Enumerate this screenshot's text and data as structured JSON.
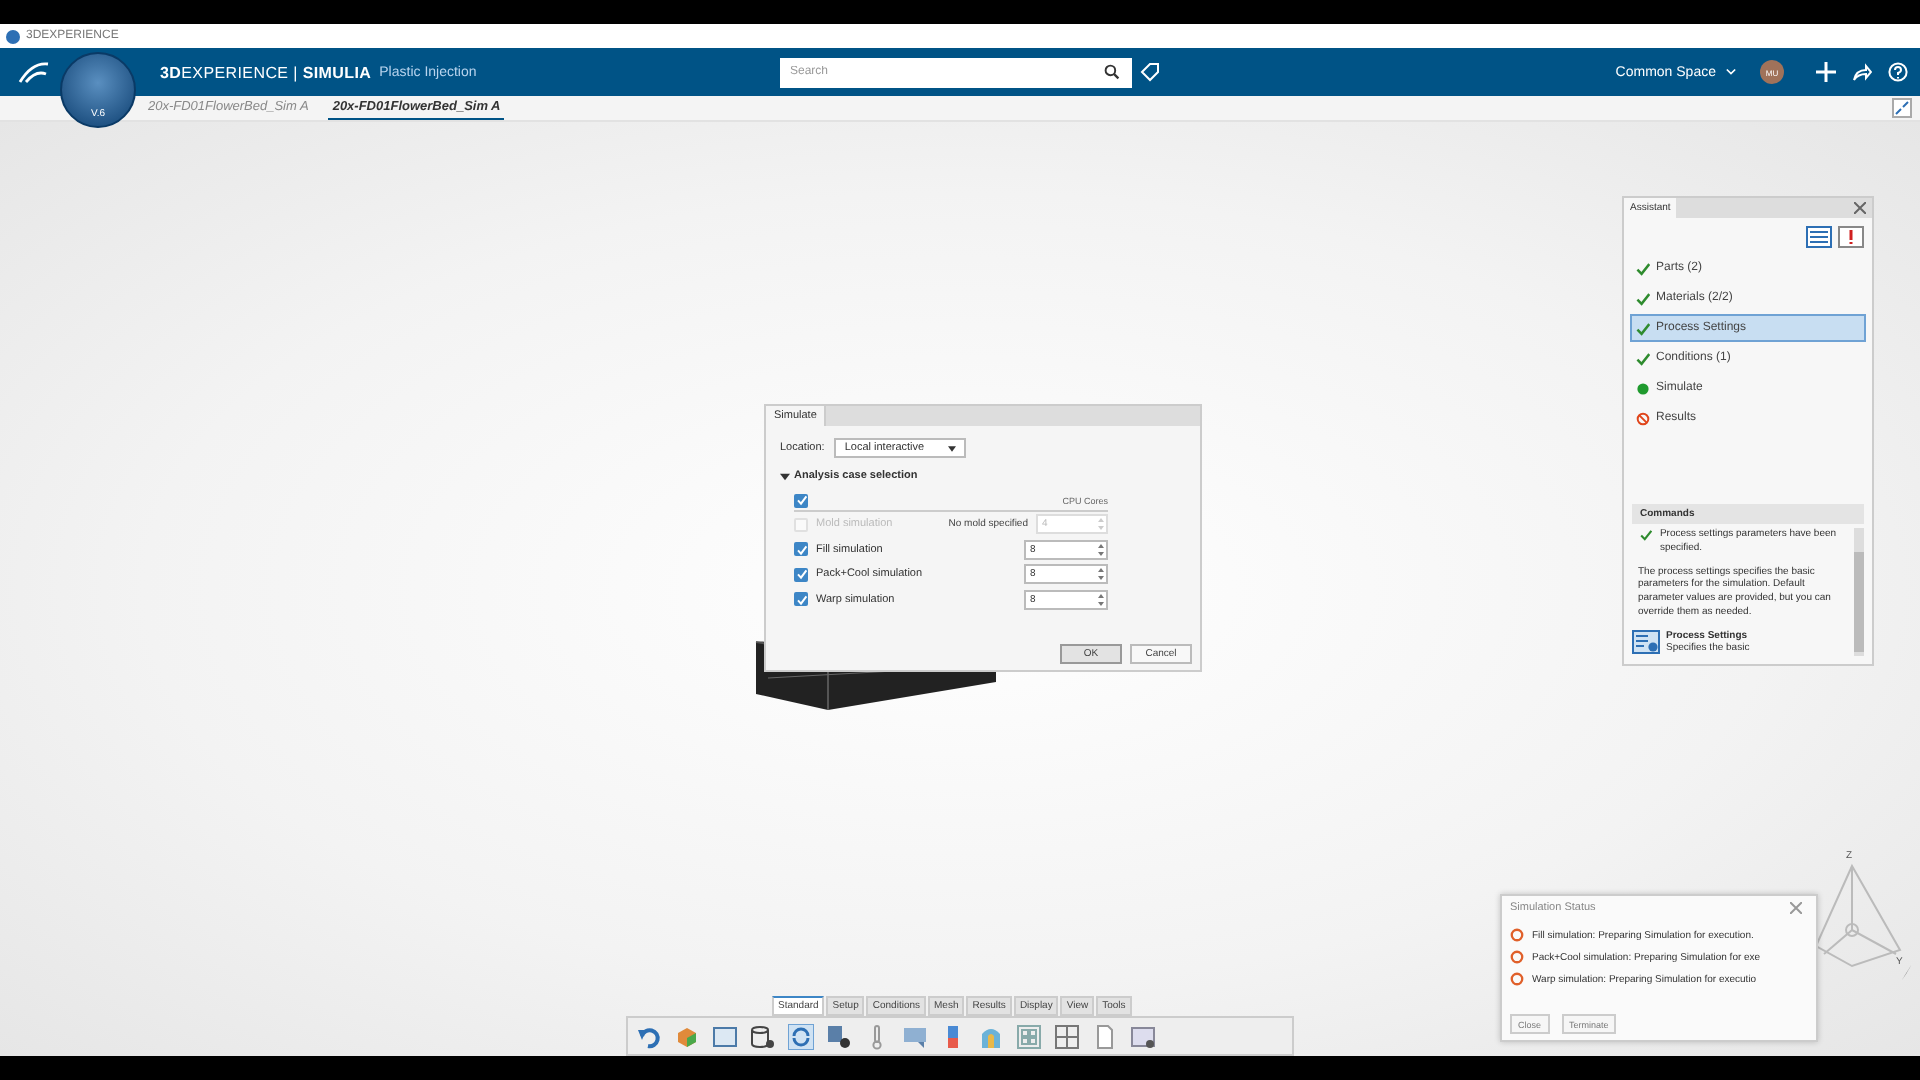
{
  "app_title": "3DEXPERIENCE",
  "header": {
    "brand": "**3D**EXPERIENCE | **SIMULIA**",
    "product": "Plastic Injection",
    "compass_label": "V.6",
    "search_placeholder": "Search",
    "space": "Common Space",
    "avatar": "MU"
  },
  "tabs": [
    {
      "label": "20x-FD01FlowerBed_Sim A",
      "selected": false
    },
    {
      "label": "20x-FD01FlowerBed_Sim A",
      "selected": true
    }
  ],
  "simulate_dialog": {
    "title": "Simulate",
    "location_label": "Location:",
    "location_value": "Local interactive",
    "section": "Analysis case selection",
    "expanded": true,
    "all_checked": true,
    "cores_header": "CPU Cores",
    "rows": [
      {
        "label": "Mold simulation",
        "checked": false,
        "disabled": true,
        "note": "No mold specified",
        "cores": "4"
      },
      {
        "label": "Fill simulation",
        "checked": true,
        "disabled": false,
        "cores": "8"
      },
      {
        "label": "Pack+Cool simulation",
        "checked": true,
        "disabled": false,
        "cores": "8"
      },
      {
        "label": "Warp simulation",
        "checked": true,
        "disabled": false,
        "cores": "8"
      }
    ],
    "buttons": [
      {
        "label": "OK",
        "kind": "default"
      },
      {
        "label": "Cancel",
        "kind": "normal"
      }
    ]
  },
  "assistant": {
    "title": "Assistant",
    "steps": [
      {
        "label": "Parts (2)",
        "kind": "done",
        "selected": false
      },
      {
        "label": "Materials (2/2)",
        "kind": "done",
        "selected": false
      },
      {
        "label": "Process Settings",
        "kind": "done",
        "selected": true
      },
      {
        "label": "Conditions (1)",
        "kind": "done",
        "selected": false
      },
      {
        "label": "Simulate",
        "kind": "ready",
        "selected": false
      },
      {
        "label": "Results",
        "kind": "blocked",
        "selected": false
      }
    ],
    "commands_title": "Commands",
    "message": "Process settings parameters have been specified.",
    "description": "The process settings specifies the basic parameters for the simulation. Default parameter values are provided, but you can override them as needed.",
    "command_title": "Process Settings",
    "command_desc": "Specifies the basic"
  },
  "status_window": {
    "title": "Simulation Status",
    "items": [
      "Fill simulation: Preparing Simulation for execution.",
      "Pack+Cool simulation: Preparing Simulation for exe",
      "Warp simulation: Preparing Simulation for executio"
    ],
    "buttons": [
      {
        "label": "Close",
        "disabled": true
      },
      {
        "label": "Terminate",
        "disabled": true
      }
    ]
  },
  "axes": {
    "z": "Z",
    "y": "Y"
  },
  "toolbar_tabs": [
    {
      "label": "Standard",
      "selected": true
    },
    {
      "label": "Setup",
      "selected": false
    },
    {
      "label": "Conditions",
      "selected": false
    },
    {
      "label": "Mesh",
      "selected": false
    },
    {
      "label": "Results",
      "selected": false
    },
    {
      "label": "Display",
      "selected": false
    },
    {
      "label": "View",
      "selected": false
    },
    {
      "label": "Tools",
      "selected": false
    }
  ]
}
